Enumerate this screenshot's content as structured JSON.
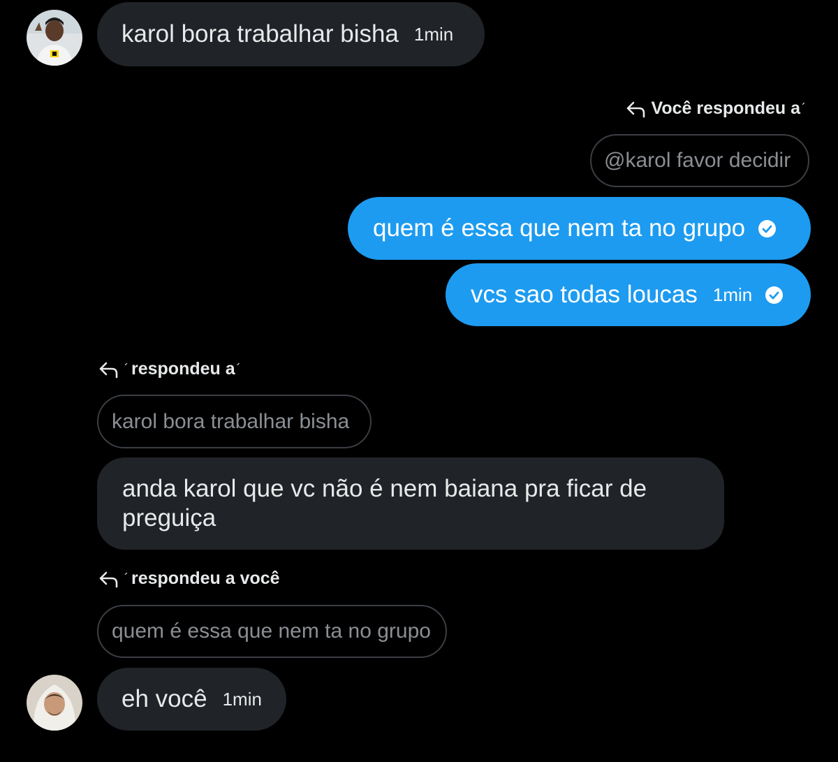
{
  "messages": [
    {
      "text": "karol bora trabalhar bisha",
      "time": "1min"
    },
    {
      "reply_header": "Você respondeu a",
      "quote": "@karol favor decidir"
    },
    {
      "text": "quem é essa que nem ta no grupo"
    },
    {
      "text": "vcs sao todas loucas",
      "time": "1min"
    },
    {
      "reply_header": "respondeu a",
      "quote": "karol bora trabalhar bisha"
    },
    {
      "text": "anda karol que vc não é nem baiana pra ficar de preguiça"
    },
    {
      "reply_header": "respondeu a você",
      "quote": "quem é essa que nem ta no grupo"
    },
    {
      "text": "eh você",
      "time": "1min"
    }
  ],
  "colors": {
    "background": "#000000",
    "incoming_bubble": "#202327",
    "outgoing_bubble": "#1d9bf0",
    "quote_border": "#3b3f44",
    "quote_text": "#8b8f94"
  },
  "icons": {
    "reply": "reply-arrow-icon",
    "seen": "check-circle-icon"
  }
}
